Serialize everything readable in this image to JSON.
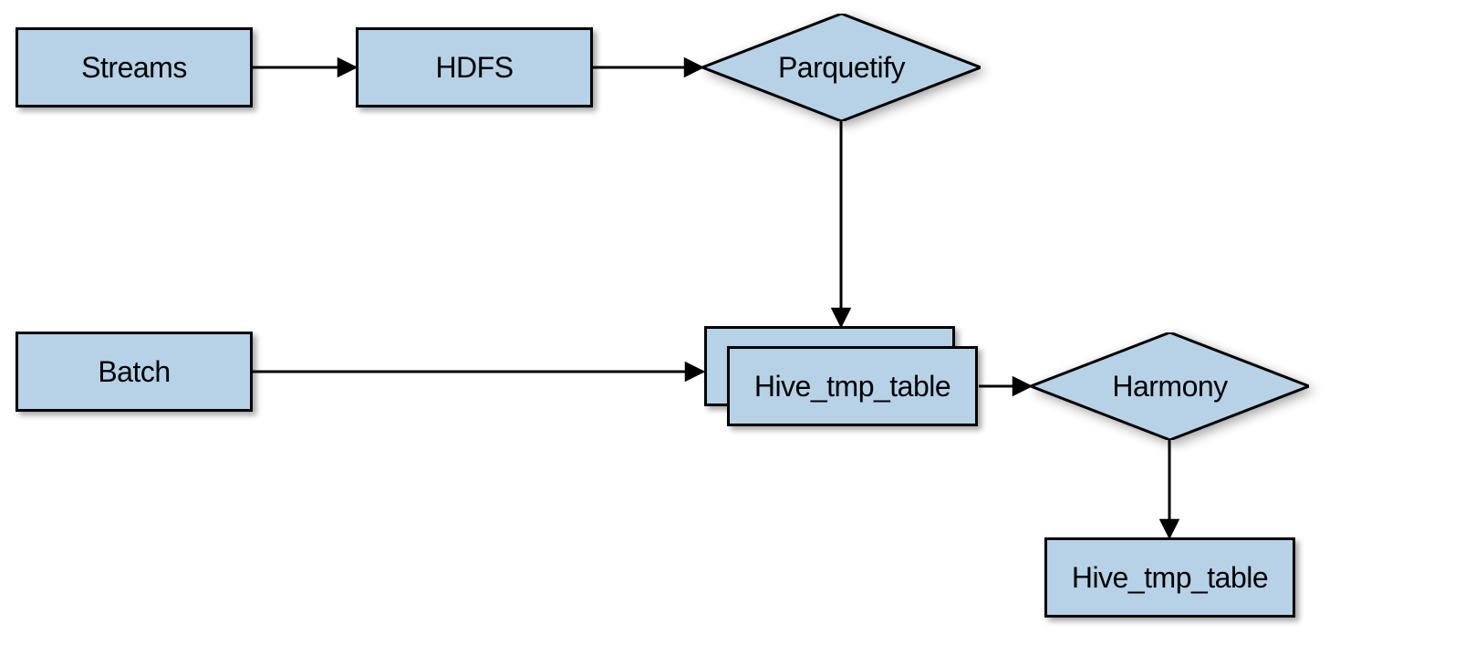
{
  "nodes": {
    "streams": "Streams",
    "hdfs": "HDFS",
    "parquetify": "Parquetify",
    "batch": "Batch",
    "hive_tmp_table_1": "Hive_tmp_table",
    "harmony": "Harmony",
    "hive_tmp_table_2": "Hive_tmp_table"
  },
  "colors": {
    "fill": "#b7d2e6",
    "stroke": "#000000"
  }
}
